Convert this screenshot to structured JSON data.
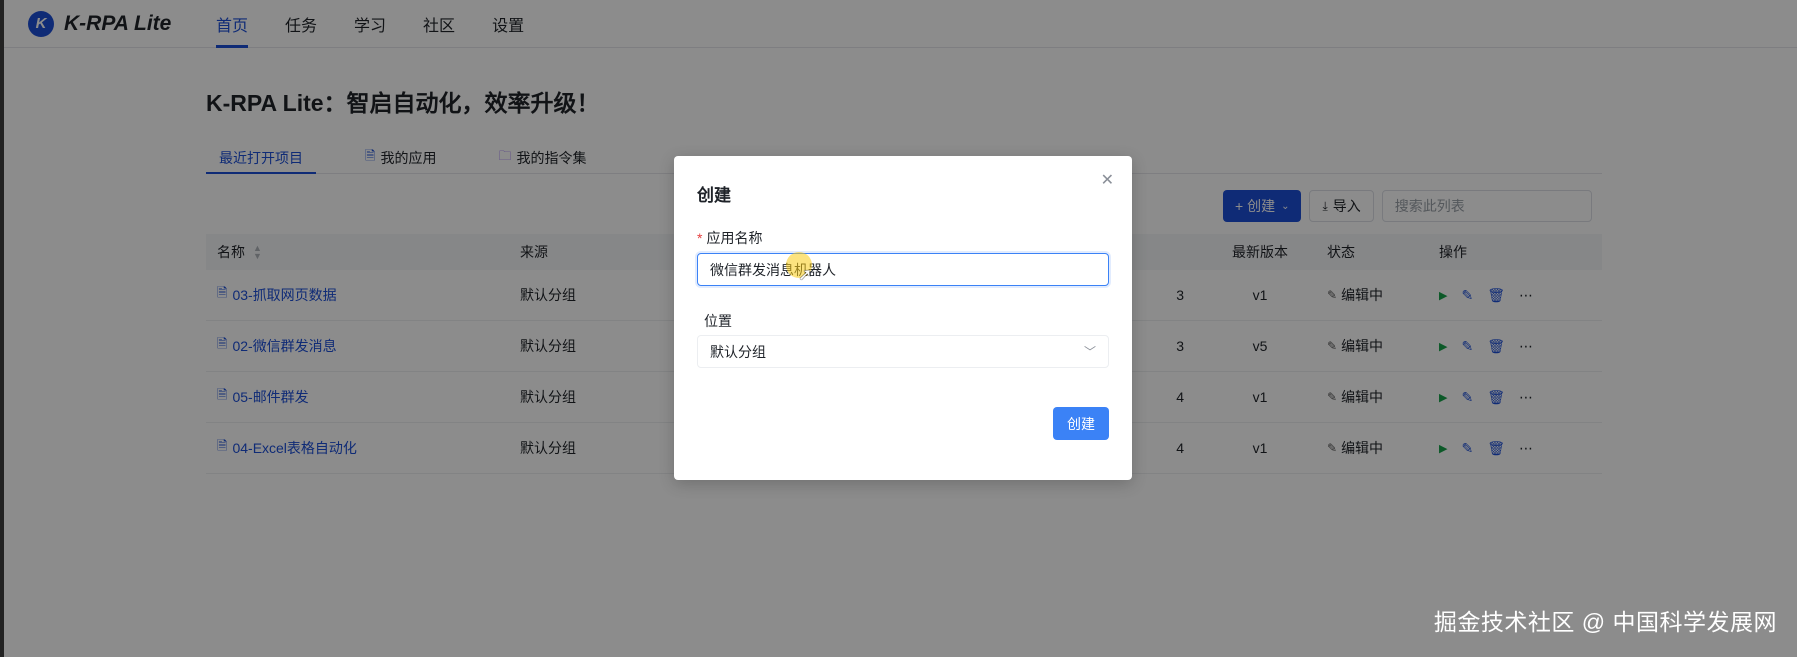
{
  "brand": {
    "logo_letter": "K",
    "name": "K-RPA Lite"
  },
  "nav": [
    {
      "label": "首页",
      "active": true
    },
    {
      "label": "任务"
    },
    {
      "label": "学习"
    },
    {
      "label": "社区"
    },
    {
      "label": "设置"
    }
  ],
  "page_title": "K-RPA Lite：智启自动化，效率升级！",
  "tabs": [
    {
      "label": "最近打开项目",
      "active": true
    },
    {
      "label": "我的应用",
      "icon": "document-icon"
    },
    {
      "label": "我的指令集",
      "icon": "folder-icon"
    }
  ],
  "toolbar": {
    "create_label": "+ 创建",
    "import_label": "导入",
    "search_placeholder": "搜索此列表"
  },
  "table": {
    "headers": {
      "name": "名称",
      "source": "来源",
      "version": "最新版本",
      "status": "状态",
      "ops": "操作"
    },
    "rows": [
      {
        "name": "03-抓取网页数据",
        "source": "默认分组",
        "time_tail": "3",
        "version": "v1",
        "status": "编辑中"
      },
      {
        "name": "02-微信群发消息",
        "source": "默认分组",
        "time_tail": "3",
        "version": "v5",
        "status": "编辑中"
      },
      {
        "name": "05-邮件群发",
        "source": "默认分组",
        "time_tail": "4",
        "version": "v1",
        "status": "编辑中"
      },
      {
        "name": "04-Excel表格自动化",
        "source": "默认分组",
        "time_tail": "4",
        "version": "v1",
        "status": "编辑中"
      }
    ]
  },
  "modal": {
    "title": "创建",
    "name_label": "应用名称",
    "required_mark": "*",
    "name_value": "微信群发消息机器人",
    "location_label": "位置",
    "location_value": "默认分组",
    "submit_label": "创建"
  },
  "watermark": "掘金技术社区 @ 中国科学发展网",
  "colors": {
    "accent": "#1d4fd8",
    "button_blue": "#3b82f6",
    "play_green": "#16a34a",
    "required_red": "#e53e3e"
  }
}
